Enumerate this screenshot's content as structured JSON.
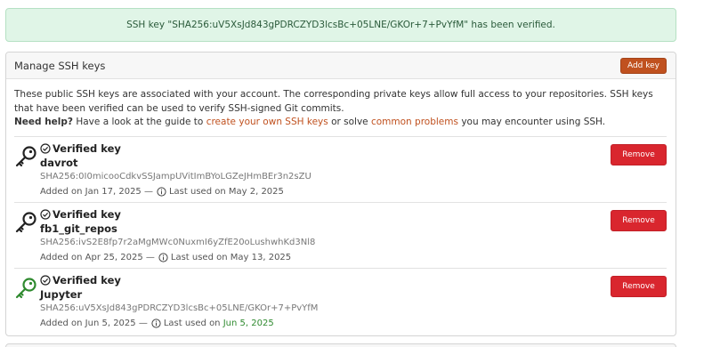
{
  "flash": {
    "message": "SSH key \"SHA256:uV5XsJd843gPDRCZYD3lcsBc+05LNE/GKOr+7+PvYfM\" has been verified."
  },
  "panel": {
    "title": "Manage SSH keys",
    "add_label": "Add key",
    "intro_text": "These public SSH keys are associated with your account. The corresponding private keys allow full access to your repositories. SSH keys that have been verified can be used to verify SSH-signed Git commits.",
    "help_label": "Need help?",
    "help_pre": " Have a look at the guide to ",
    "help_link1": "create your own SSH keys",
    "help_mid": " or solve ",
    "help_link2": "common problems",
    "help_post": " you may encounter using SSH."
  },
  "keys": [
    {
      "status": "Verified key",
      "name": "davrot",
      "fingerprint": "SHA256:0I0micooCdkvSSJampUVitImBYoLGZeJHmBEr3n2sZU",
      "added": "Added on Jan 17, 2025 —",
      "last_used_label": "Last used on",
      "last_used": "May 2, 2025",
      "remove_label": "Remove",
      "icon_color": "#222222"
    },
    {
      "status": "Verified key",
      "name": "fb1_git_repos",
      "fingerprint": "SHA256:ivS2E8fp7r2aMgMWc0NuxmI6yZfE20oLushwhKd3Nl8",
      "added": "Added on Apr 25, 2025 —",
      "last_used_label": "Last used on",
      "last_used": "May 13, 2025",
      "remove_label": "Remove",
      "icon_color": "#222222"
    },
    {
      "status": "Verified key",
      "name": "Jupyter",
      "fingerprint": "SHA256:uV5XsJd843gPDRCZYD3lcsBc+05LNE/GKOr+7+PvYfM",
      "added": "Added on Jun 5, 2025 —",
      "last_used_label": "Last used on",
      "last_used": "Jun 5, 2025",
      "remove_label": "Remove",
      "icon_color": "#2f8a2f"
    }
  ],
  "colors": {
    "accent": "#c0511f",
    "danger": "#d9262e",
    "success_bg": "#e0f5e7",
    "recent": "#2f8a2f"
  }
}
